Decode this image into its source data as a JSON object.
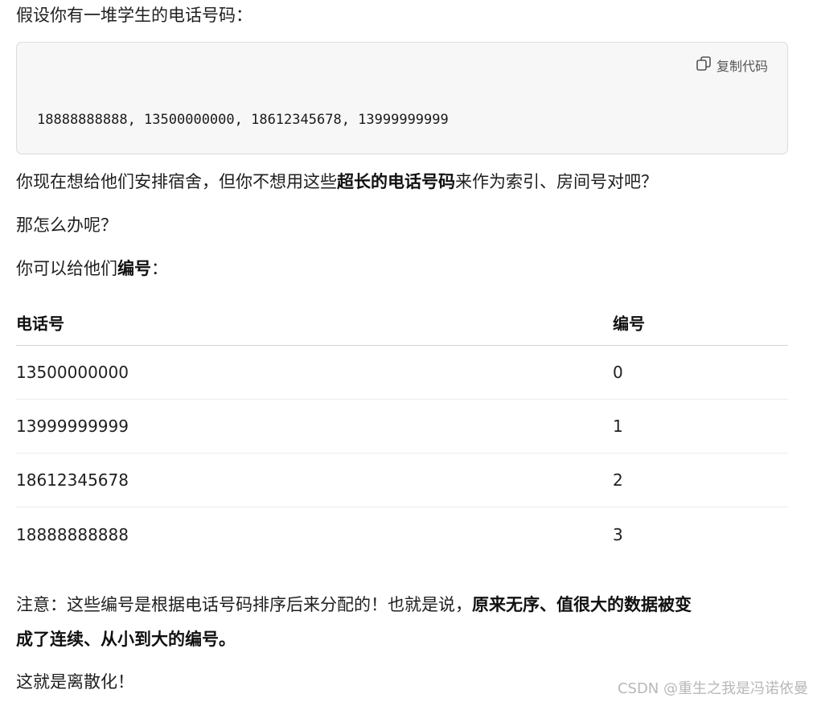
{
  "intro": "假设你有一堆学生的电话号码：",
  "code": {
    "copy_label": "复制代码",
    "copy_icon": "copy-icon",
    "content": "18888888888, 13500000000, 18612345678, 13999999999"
  },
  "para1": {
    "before": "你现在想给他们安排宿舍，但你不想用这些",
    "bold": "超长的电话号码",
    "after": "来作为索引、房间号对吧？"
  },
  "para2": "那怎么办呢？",
  "para3": {
    "before": "你可以给他们",
    "bold": "编号",
    "after": "："
  },
  "table": {
    "headers": [
      "电话号",
      "编号"
    ],
    "rows": [
      [
        "13500000000",
        "0"
      ],
      [
        "13999999999",
        "1"
      ],
      [
        "18612345678",
        "2"
      ],
      [
        "18888888888",
        "3"
      ]
    ]
  },
  "note": {
    "before": "注意：这些编号是根据电话号码排序后来分配的！也就是说，",
    "bold_line1": "原来无序、值很大的数据被变",
    "bold_line2": "成了连续、从小到大的编号。"
  },
  "conclusion": "这就是离散化！",
  "watermark": "CSDN @重生之我是冯诺依曼"
}
